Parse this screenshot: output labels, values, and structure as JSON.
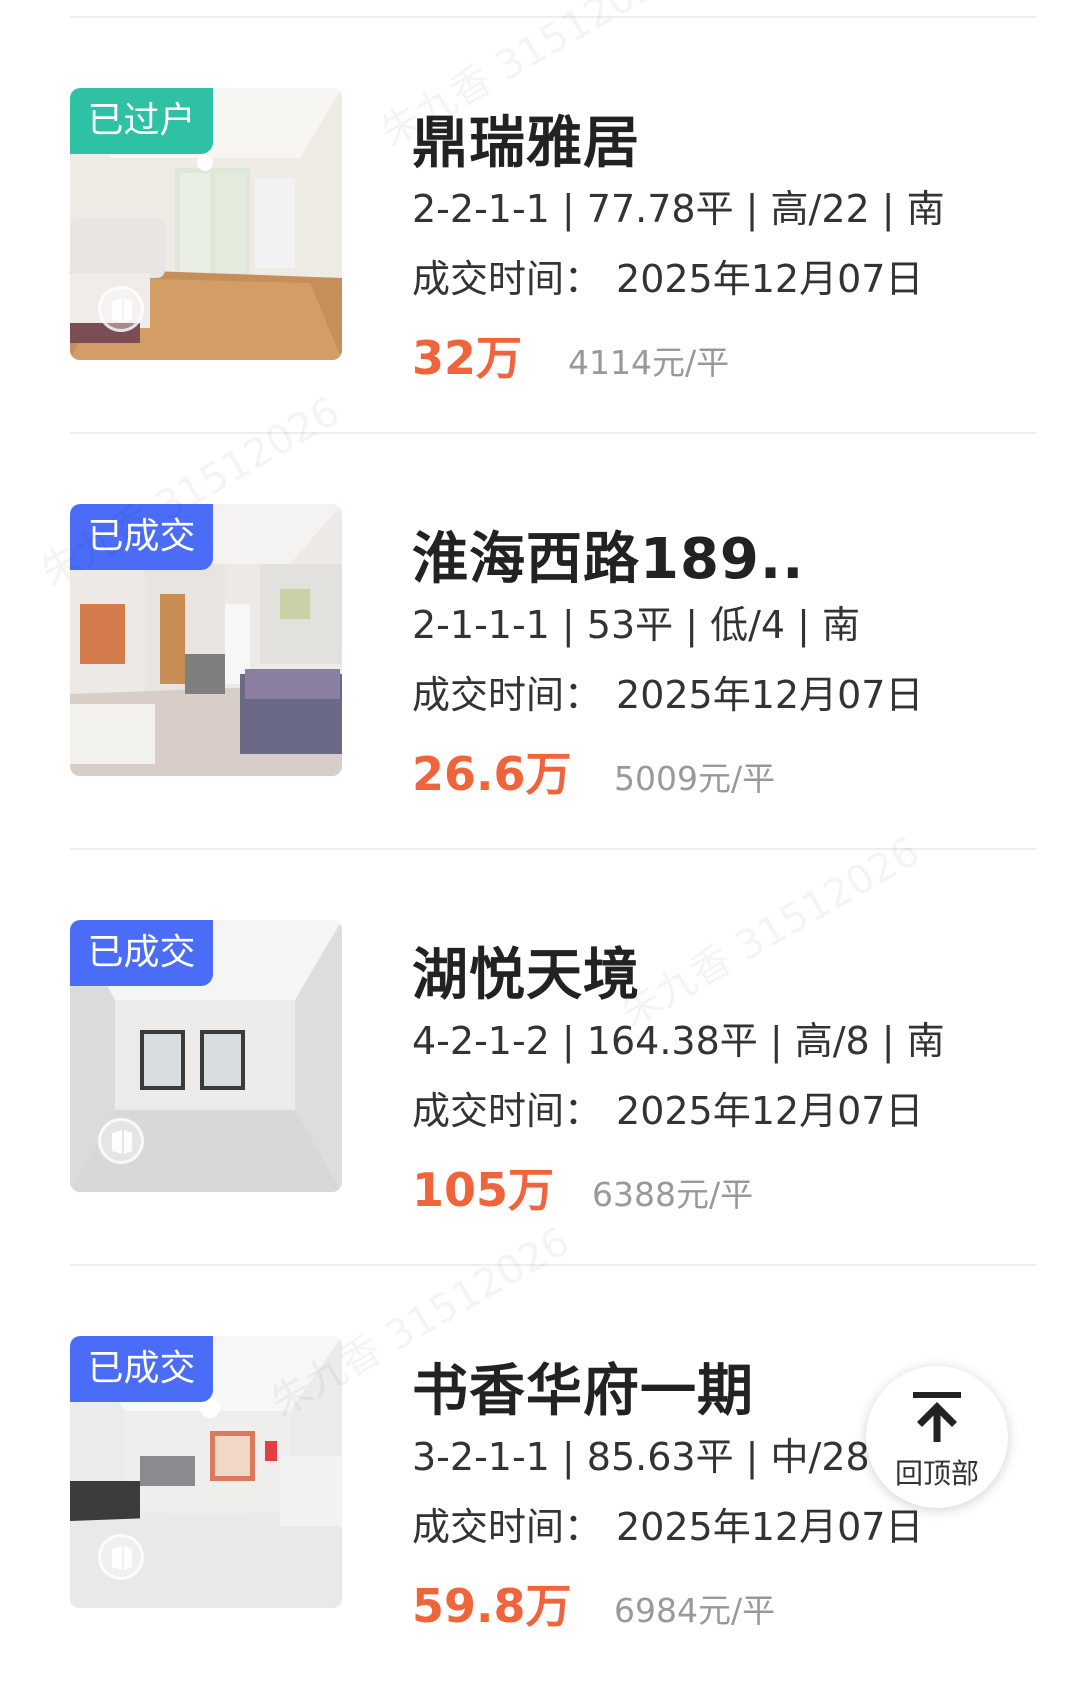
{
  "listings": [
    {
      "badge": "已过户",
      "badge_color": "#2ec1a3",
      "title": "鼎瑞雅居",
      "specs": "2-2-1-1 | 77.78平 | 高/22 | 南",
      "date_label": "成交时间：",
      "date": "2025年12月07日",
      "price": "32万",
      "unit_price": "4114元/平",
      "has_vr": true
    },
    {
      "badge": "已成交",
      "badge_color": "#4a6cf7",
      "title": "淮海西路189..",
      "specs": "2-1-1-1 | 53平 | 低/4 | 南",
      "date_label": "成交时间：",
      "date": "2025年12月07日",
      "price": "26.6万",
      "unit_price": "5009元/平",
      "has_vr": false
    },
    {
      "badge": "已成交",
      "badge_color": "#4a6cf7",
      "title": "湖悦天境",
      "specs": "4-2-1-2 | 164.38平 | 高/8 | 南",
      "date_label": "成交时间：",
      "date": "2025年12月07日",
      "price": "105万",
      "unit_price": "6388元/平",
      "has_vr": true
    },
    {
      "badge": "已成交",
      "badge_color": "#4a6cf7",
      "title": "书香华府一期",
      "specs": "3-2-1-1 | 85.63平 | 中/28 |",
      "date_label": "成交时间：",
      "date": "2025年12月07日",
      "price": "59.8万",
      "unit_price": "6984元/平",
      "has_vr": true
    }
  ],
  "back_to_top": {
    "label": "回顶部",
    "icon": "arrow-up-icon"
  },
  "watermark_text": "朱九香 31512026",
  "colors": {
    "price": "#f0643c",
    "unit_price": "#999999",
    "divider": "#eeeeee"
  }
}
